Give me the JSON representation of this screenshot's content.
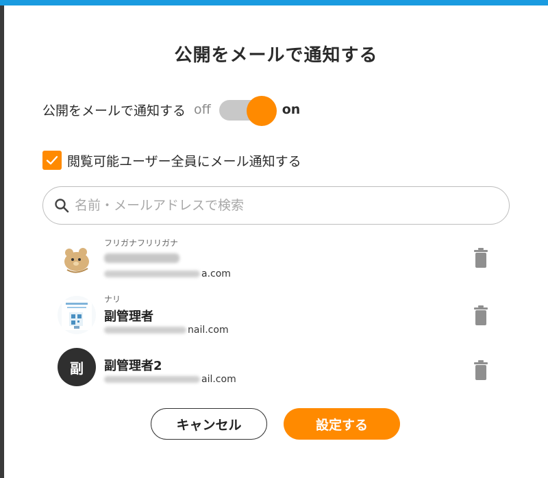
{
  "dialog": {
    "title": "公開をメールで通知する"
  },
  "notify_toggle": {
    "label": "公開をメールで通知する",
    "off_label": "off",
    "on_label": "on",
    "state": "on"
  },
  "notify_all": {
    "label": "閲覧可能ユーザー全員にメール通知する",
    "checked": true
  },
  "search": {
    "placeholder": "名前・メールアドレスで検索",
    "value": ""
  },
  "users": [
    {
      "kana": "フリガナフリリガナ",
      "name": "",
      "email_suffix": "a.com",
      "avatar": "bear-illustration"
    },
    {
      "kana": "ナリ",
      "name": "副管理者",
      "email_suffix": "nail.com",
      "avatar": "qr-card-image"
    },
    {
      "kana": "",
      "name": "副管理者2",
      "email_suffix": "ail.com",
      "avatar_text": "副",
      "avatar": "initial-avatar"
    }
  ],
  "actions": {
    "cancel_label": "キャンセル",
    "submit_label": "設定する"
  },
  "colors": {
    "accent": "#ff8a00",
    "top_bar": "#1a9be0",
    "avatar_dark": "#2f2f2f",
    "trash": "#8f8f8f"
  }
}
